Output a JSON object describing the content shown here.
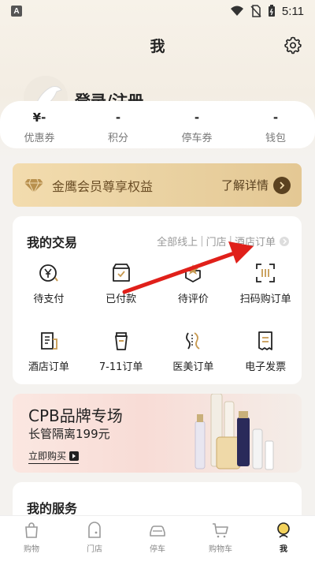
{
  "status_bar": {
    "badge": "A",
    "time": "5:11"
  },
  "header": {
    "title": "我"
  },
  "profile": {
    "login_label": "登录/注册"
  },
  "stats": [
    {
      "value": "¥-",
      "label": "优惠券"
    },
    {
      "value": "-",
      "label": "积分"
    },
    {
      "value": "-",
      "label": "停车券"
    },
    {
      "value": "-",
      "label": "钱包"
    }
  ],
  "member_banner": {
    "text": "金鹰会员尊享权益",
    "more": "了解详情"
  },
  "trade": {
    "title": "我的交易",
    "filters": [
      "全部线上",
      "门店",
      "酒店订单"
    ],
    "items": [
      {
        "label": "待支付",
        "icon": "pending-payment-icon"
      },
      {
        "label": "已付款",
        "icon": "paid-box-icon"
      },
      {
        "label": "待评价",
        "icon": "review-icon"
      },
      {
        "label": "扫码购订单",
        "icon": "scan-order-icon"
      },
      {
        "label": "酒店订单",
        "icon": "hotel-order-icon"
      },
      {
        "label": "7-11订单",
        "icon": "cup-order-icon"
      },
      {
        "label": "医美订单",
        "icon": "medical-beauty-icon"
      },
      {
        "label": "电子发票",
        "icon": "e-invoice-icon"
      }
    ]
  },
  "promo": {
    "title": "CPB品牌专场",
    "subtitle": "长管隔离199元",
    "cta": "立即购买"
  },
  "services": {
    "title": "我的服务"
  },
  "bottom_nav": [
    {
      "label": "购物",
      "icon": "shopping-bag-icon"
    },
    {
      "label": "门店",
      "icon": "store-icon"
    },
    {
      "label": "停车",
      "icon": "car-icon"
    },
    {
      "label": "购物车",
      "icon": "cart-icon"
    },
    {
      "label": "我",
      "icon": "profile-icon",
      "active": true
    }
  ],
  "colors": {
    "accent": "#5b4220",
    "gold_banner": "#ead2a2",
    "annotation_red": "#e0201a"
  }
}
